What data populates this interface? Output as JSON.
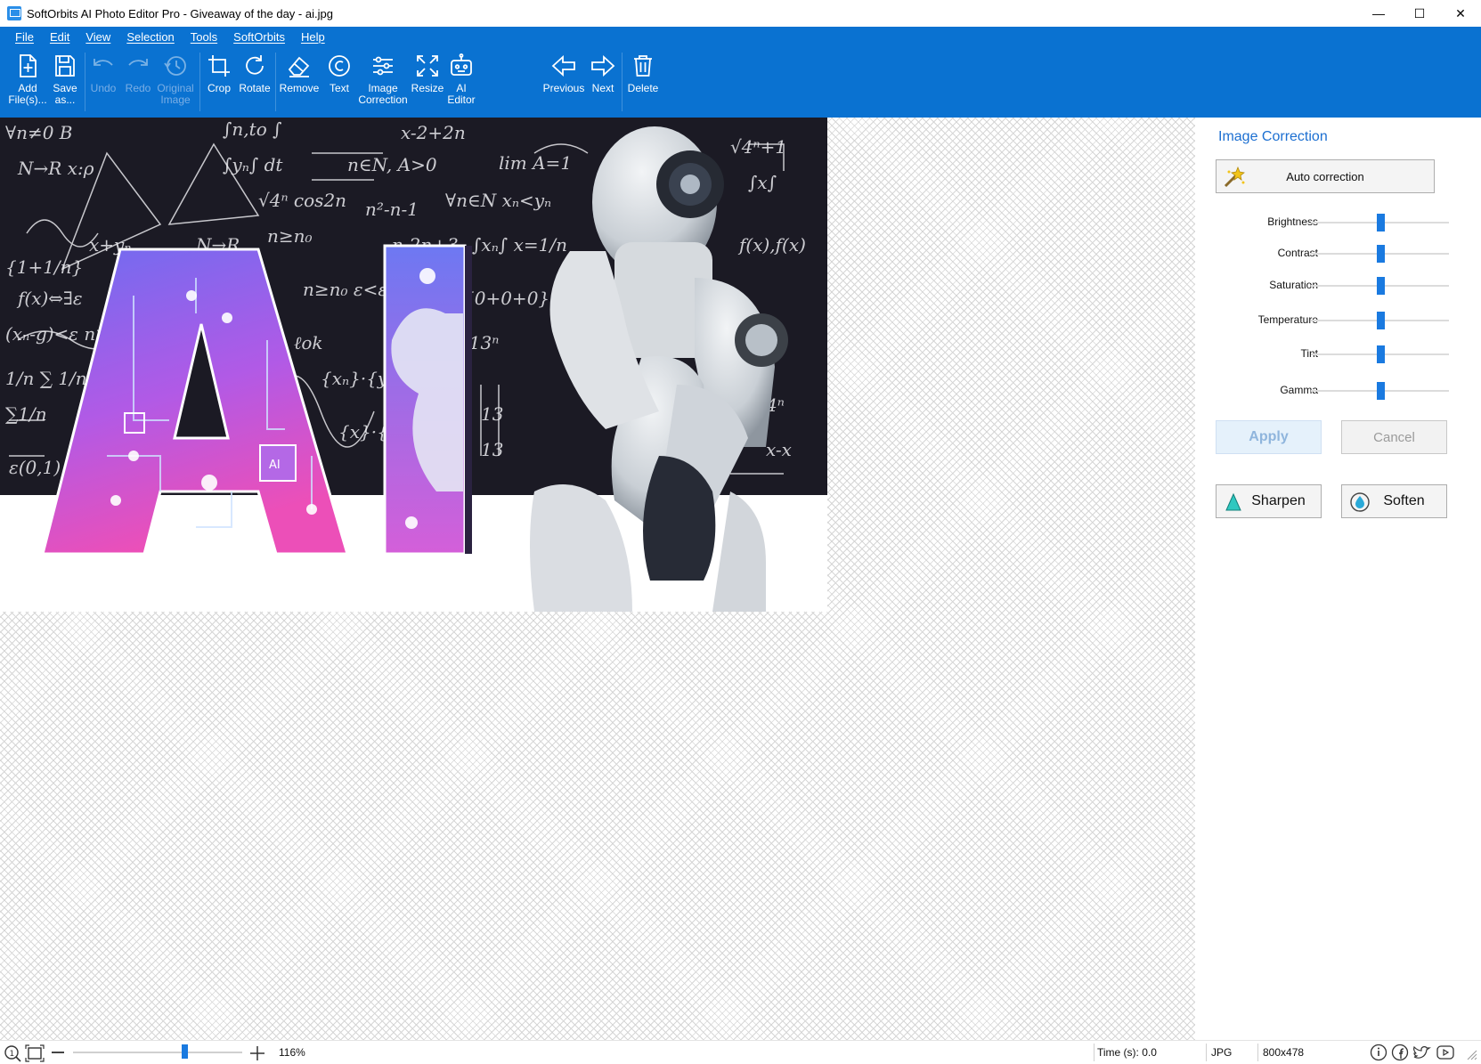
{
  "window": {
    "title": "SoftOrbits AI Photo Editor Pro - Giveaway of the day - ai.jpg",
    "controls": {
      "minimize": "—",
      "maximize": "☐",
      "close": "✕"
    }
  },
  "menu": [
    "File",
    "Edit",
    "View",
    "Selection",
    "Tools",
    "SoftOrbits",
    "Help"
  ],
  "toolbar": {
    "add_files": "Add\nFile(s)...",
    "save_as": "Save\nas...",
    "undo": "Undo",
    "redo": "Redo",
    "original_image": "Original\nImage",
    "crop": "Crop",
    "rotate": "Rotate",
    "remove": "Remove",
    "text": "Text",
    "image_correction": "Image\nCorrection",
    "resize": "Resize",
    "ai_editor": "AI\nEditor",
    "previous": "Previous",
    "next": "Next",
    "delete": "Delete"
  },
  "photo": {
    "letters": "AI",
    "chip_label": "AI"
  },
  "panel": {
    "title": "Image Correction",
    "auto_correction": "Auto correction",
    "sliders": [
      {
        "label": "Brightness",
        "value": 0.5
      },
      {
        "label": "Contrast",
        "value": 0.5
      },
      {
        "label": "Saturation",
        "value": 0.5
      },
      {
        "label": "Temperature",
        "value": 0.5
      },
      {
        "label": "Tint",
        "value": 0.5
      },
      {
        "label": "Gamma",
        "value": 0.5
      }
    ],
    "apply": "Apply",
    "cancel": "Cancel",
    "sharpen": "Sharpen",
    "soften": "Soften"
  },
  "status": {
    "zoom": "116%",
    "zoom_slider_value": 0.66,
    "time": "Time (s): 0.0",
    "format": "JPG",
    "dimensions": "800x478"
  },
  "colors": {
    "accent": "#0a72d1",
    "panel_title": "#1c6fd1",
    "slider_thumb": "#1a7ae0"
  }
}
